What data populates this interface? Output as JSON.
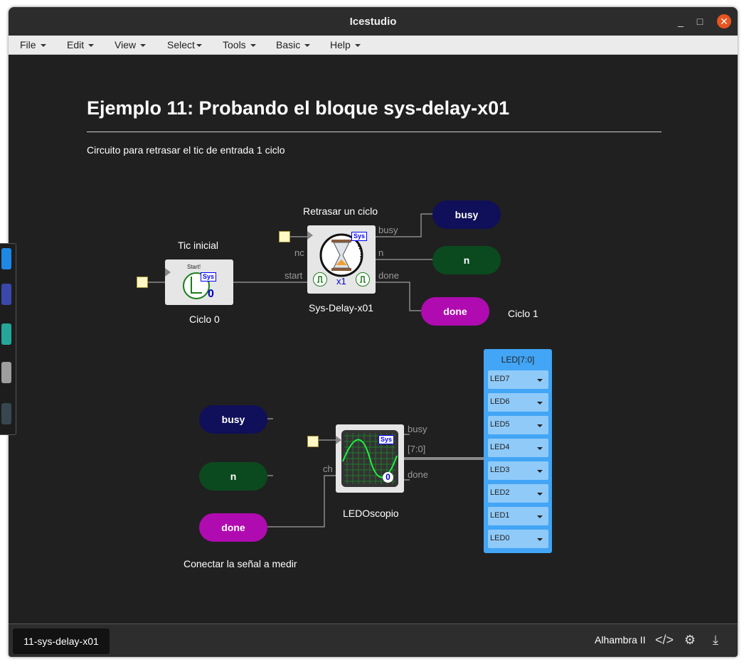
{
  "window": {
    "title": "Icestudio",
    "min": "_",
    "max": "□",
    "close": "✕"
  },
  "menu": [
    "File",
    "Edit",
    "View",
    "Select",
    "Tools",
    "Basic",
    "Help"
  ],
  "doc": {
    "title": "Ejemplo 11: Probando el bloque sys-delay-x01",
    "description": "Circuito para retrasar el tic de entrada 1 ciclo"
  },
  "circuit1": {
    "start_block_title": "Tic inicial",
    "start_block_name": "Ciclo 0",
    "start_block_text": "Start!",
    "start_block_value": "0",
    "delay_title": "Retrasar un ciclo",
    "delay_name": "Sys-Delay-x01",
    "delay_mult": "x1",
    "ports_in": [
      "nc",
      "start"
    ],
    "ports_out": [
      "busy",
      "n",
      "done"
    ],
    "outputs": [
      "busy",
      "n",
      "done"
    ],
    "note": "Ciclo 1"
  },
  "circuit2": {
    "inputs": [
      "busy",
      "n",
      "done"
    ],
    "scope_name": "LEDOscopio",
    "scope_value": "0",
    "port_in": "ch",
    "ports_out": [
      "busy",
      "[7:0]",
      "done"
    ],
    "note": "Conectar la señal a medir"
  },
  "sys_badge": "Sys",
  "leds": {
    "header": "LED[7:0]",
    "items": [
      "LED7",
      "LED6",
      "LED5",
      "LED4",
      "LED3",
      "LED2",
      "LED1",
      "LED0"
    ]
  },
  "status": {
    "file_tab": "11-sys-delay-x01",
    "board": "Alhambra II",
    "icons": [
      "code-icon",
      "settings-icon",
      "download-icon"
    ]
  },
  "colors": {
    "busy": "#0f0f5a",
    "n": "#0b4a1e",
    "done": "#b00bb0",
    "led_panel": "#42a5f5",
    "accent": "#e95420"
  }
}
